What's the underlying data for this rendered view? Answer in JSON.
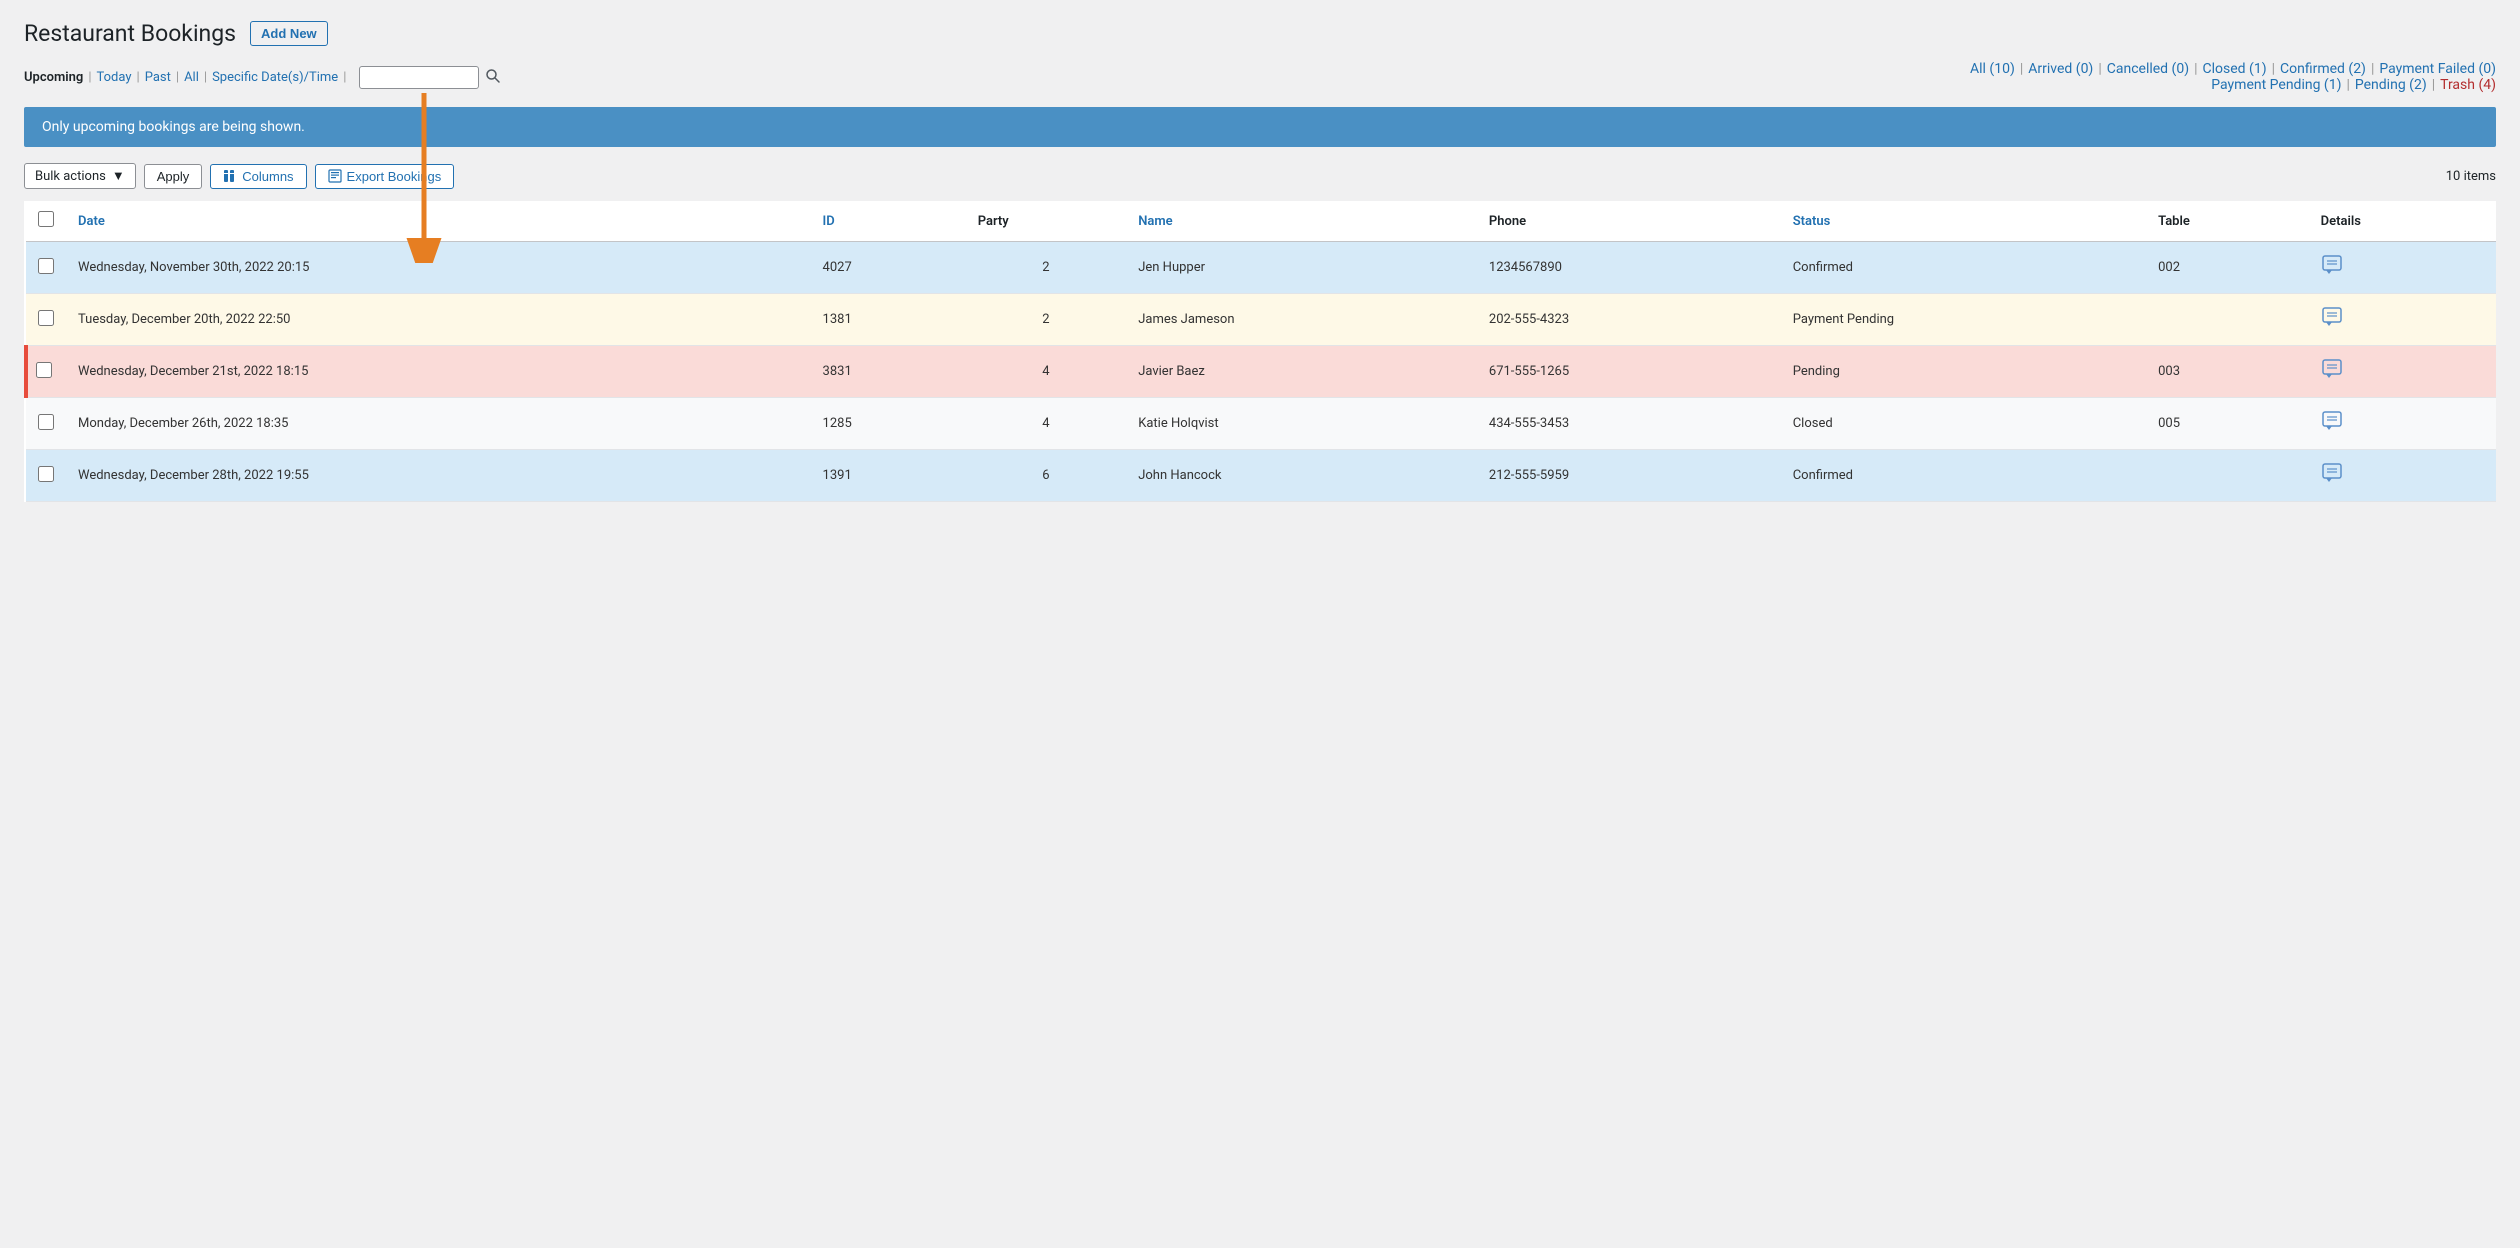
{
  "page": {
    "title": "Restaurant Bookings",
    "add_new_label": "Add New"
  },
  "filters": {
    "left": [
      {
        "label": "Upcoming",
        "active": true,
        "link": "#"
      },
      {
        "label": "Today",
        "active": false,
        "link": "#"
      },
      {
        "label": "Past",
        "active": false,
        "link": "#"
      },
      {
        "label": "All",
        "active": false,
        "link": "#"
      },
      {
        "label": "Specific Date(s)/Time",
        "active": false,
        "link": "#"
      }
    ],
    "search_placeholder": ""
  },
  "status_filters": {
    "row1": [
      {
        "label": "All",
        "count": 10
      },
      {
        "label": "Arrived",
        "count": 0
      },
      {
        "label": "Cancelled",
        "count": 0
      },
      {
        "label": "Closed",
        "count": 1
      },
      {
        "label": "Confirmed",
        "count": 2
      },
      {
        "label": "Payment Failed",
        "count": 0
      }
    ],
    "row2": [
      {
        "label": "Payment Pending",
        "count": 1
      },
      {
        "label": "Pending",
        "count": 2
      },
      {
        "label": "Trash",
        "count": 4,
        "special": "trash"
      }
    ]
  },
  "info_banner": "Only upcoming bookings are being shown.",
  "toolbar": {
    "bulk_actions_label": "Bulk actions",
    "apply_label": "Apply",
    "columns_label": "Columns",
    "export_label": "Export Bookings",
    "items_count": "10 items"
  },
  "table": {
    "columns": [
      {
        "label": "Date",
        "sortable": true
      },
      {
        "label": "ID",
        "sortable": true
      },
      {
        "label": "Party",
        "sortable": false
      },
      {
        "label": "Name",
        "sortable": true
      },
      {
        "label": "Phone",
        "sortable": false
      },
      {
        "label": "Status",
        "sortable": true
      },
      {
        "label": "Table",
        "sortable": false
      },
      {
        "label": "Details",
        "sortable": false
      }
    ],
    "rows": [
      {
        "date": "Wednesday, November 30th, 2022 20:15",
        "id": "4027",
        "party": "2",
        "name": "Jen Hupper",
        "phone": "1234567890",
        "status": "Confirmed",
        "table": "002",
        "row_class": "row-blue"
      },
      {
        "date": "Tuesday, December 20th, 2022 22:50",
        "id": "1381",
        "party": "2",
        "name": "James Jameson",
        "phone": "202-555-4323",
        "status": "Payment Pending",
        "table": "",
        "row_class": "row-yellow"
      },
      {
        "date": "Wednesday, December 21st, 2022 18:15",
        "id": "3831",
        "party": "4",
        "name": "Javier Baez",
        "phone": "671-555-1265",
        "status": "Pending",
        "table": "003",
        "row_class": "row-red"
      },
      {
        "date": "Monday, December 26th, 2022 18:35",
        "id": "1285",
        "party": "4",
        "name": "Katie Holqvist",
        "phone": "434-555-3453",
        "status": "Closed",
        "table": "005",
        "row_class": "row-gray"
      },
      {
        "date": "Wednesday, December 28th, 2022 19:55",
        "id": "1391",
        "party": "6",
        "name": "John Hancock",
        "phone": "212-555-5959",
        "status": "Confirmed",
        "table": "",
        "row_class": "row-blue-alt"
      }
    ]
  }
}
